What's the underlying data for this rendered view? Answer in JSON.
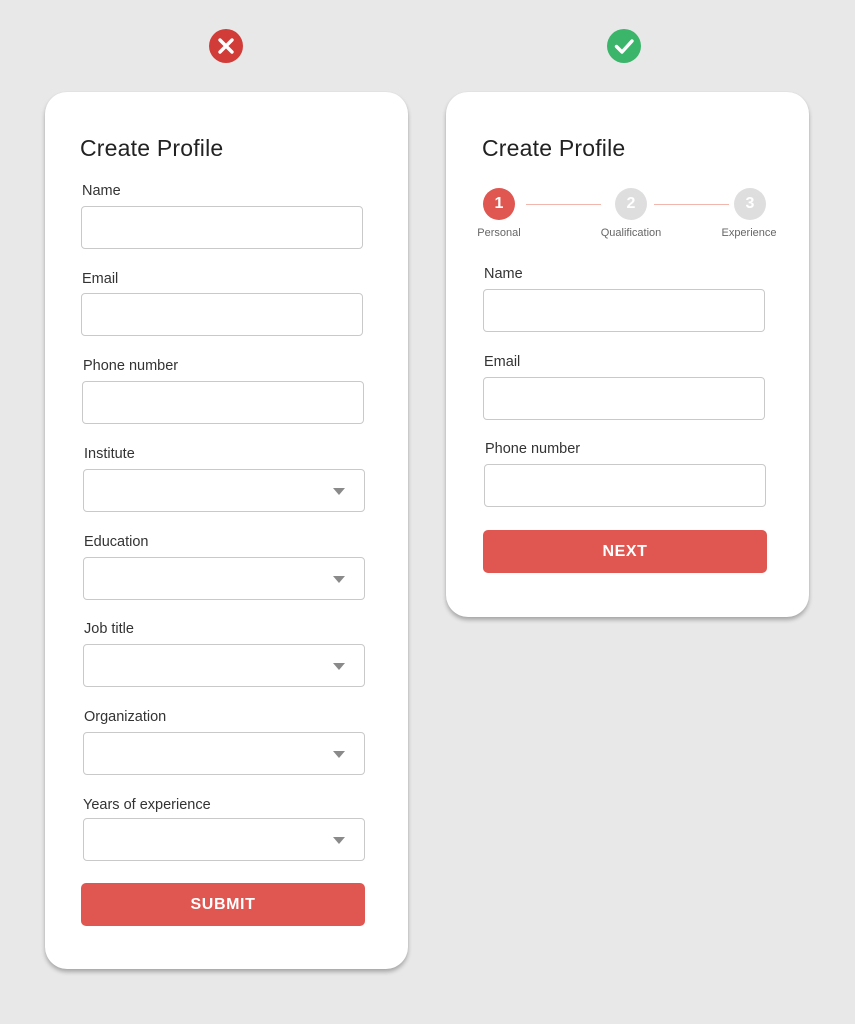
{
  "colors": {
    "background": "#e8e8e8",
    "accent": "#e05650",
    "bad_badge": "#d23c38",
    "good_badge": "#3ab56a",
    "inactive_step": "#dedede"
  },
  "bad_example": {
    "badge_icon": "x-circle-icon",
    "title": "Create Profile",
    "fields": [
      {
        "label": "Name",
        "type": "text",
        "value": ""
      },
      {
        "label": "Email",
        "type": "text",
        "value": ""
      },
      {
        "label": "Phone number",
        "type": "text",
        "value": ""
      },
      {
        "label": "Institute",
        "type": "select",
        "value": ""
      },
      {
        "label": "Education",
        "type": "select",
        "value": ""
      },
      {
        "label": "Job title",
        "type": "select",
        "value": ""
      },
      {
        "label": "Organization",
        "type": "select",
        "value": ""
      },
      {
        "label": "Years of experience",
        "type": "select",
        "value": ""
      }
    ],
    "submit_label": "SUBMIT"
  },
  "good_example": {
    "badge_icon": "check-circle-icon",
    "title": "Create Profile",
    "steps": [
      {
        "number": "1",
        "label": "Personal",
        "active": true
      },
      {
        "number": "2",
        "label": "Qualification",
        "active": false
      },
      {
        "number": "3",
        "label": "Experience",
        "active": false
      }
    ],
    "fields": [
      {
        "label": "Name",
        "type": "text",
        "value": ""
      },
      {
        "label": "Email",
        "type": "text",
        "value": ""
      },
      {
        "label": "Phone number",
        "type": "text",
        "value": ""
      }
    ],
    "next_label": "NEXT"
  }
}
